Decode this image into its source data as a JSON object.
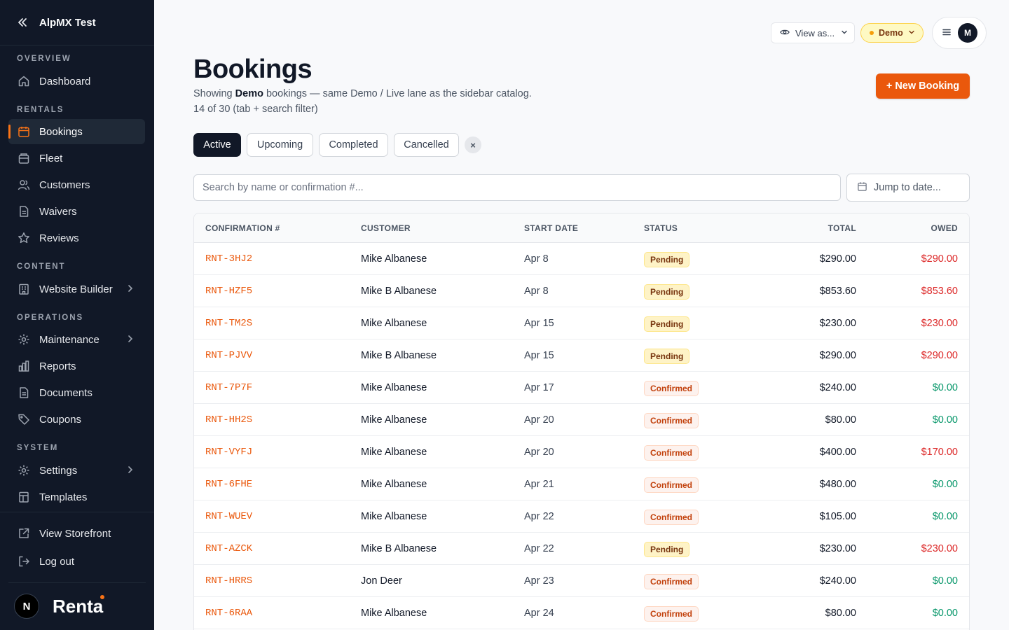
{
  "sidebar": {
    "org_name": "AlpMX Test",
    "sections": {
      "overview": "OVERVIEW",
      "rentals": "RENTALS",
      "content": "CONTENT",
      "operations": "OPERATIONS",
      "system": "SYSTEM"
    },
    "items": {
      "dashboard": "Dashboard",
      "bookings": "Bookings",
      "fleet": "Fleet",
      "customers": "Customers",
      "waivers": "Waivers",
      "reviews": "Reviews",
      "website_builder": "Website Builder",
      "maintenance": "Maintenance",
      "reports": "Reports",
      "documents": "Documents",
      "coupons": "Coupons",
      "settings": "Settings",
      "templates": "Templates"
    },
    "footer_links": {
      "view_storefront": "View Storefront",
      "log_out": "Log out"
    },
    "brand": "Renta",
    "footer_avatar": "N",
    "active_item": "bookings",
    "accent_color": "#f97316"
  },
  "topbar": {
    "view_as": "View as...",
    "mode_badge": "Demo",
    "user_initial": "M"
  },
  "page": {
    "title": "Bookings",
    "subtitle_prefix": "Showing ",
    "subtitle_mode": "Demo",
    "subtitle_suffix": " bookings — same Demo / Live lane as the sidebar catalog.",
    "count_line": "14 of 30 (tab + search filter)",
    "new_booking_label": "+ New Booking"
  },
  "tabs": [
    "Active",
    "Upcoming",
    "Completed",
    "Cancelled"
  ],
  "active_tab": "Active",
  "clear_label": "×",
  "search": {
    "placeholder": "Search by name or confirmation #...",
    "value": ""
  },
  "date_jump": {
    "placeholder": "Jump to date..."
  },
  "table": {
    "columns": [
      "CONFIRMATION #",
      "CUSTOMER",
      "START DATE",
      "STATUS",
      "TOTAL",
      "OWED"
    ],
    "rows": [
      {
        "conf": "RNT-3HJ2",
        "customer": "Mike Albanese",
        "date": "Apr 8",
        "status": "Pending",
        "total": "$290.00",
        "owed": "$290.00"
      },
      {
        "conf": "RNT-HZF5",
        "customer": "Mike B Albanese",
        "date": "Apr 8",
        "status": "Pending",
        "total": "$853.60",
        "owed": "$853.60"
      },
      {
        "conf": "RNT-TM2S",
        "customer": "Mike Albanese",
        "date": "Apr 15",
        "status": "Pending",
        "total": "$230.00",
        "owed": "$230.00"
      },
      {
        "conf": "RNT-PJVV",
        "customer": "Mike B Albanese",
        "date": "Apr 15",
        "status": "Pending",
        "total": "$290.00",
        "owed": "$290.00"
      },
      {
        "conf": "RNT-7P7F",
        "customer": "Mike Albanese",
        "date": "Apr 17",
        "status": "Confirmed",
        "total": "$240.00",
        "owed": "$0.00"
      },
      {
        "conf": "RNT-HH2S",
        "customer": "Mike Albanese",
        "date": "Apr 20",
        "status": "Confirmed",
        "total": "$80.00",
        "owed": "$0.00"
      },
      {
        "conf": "RNT-VYFJ",
        "customer": "Mike Albanese",
        "date": "Apr 20",
        "status": "Confirmed",
        "total": "$400.00",
        "owed": "$170.00"
      },
      {
        "conf": "RNT-6FHE",
        "customer": "Mike Albanese",
        "date": "Apr 21",
        "status": "Confirmed",
        "total": "$480.00",
        "owed": "$0.00"
      },
      {
        "conf": "RNT-WUEV",
        "customer": "Mike Albanese",
        "date": "Apr 22",
        "status": "Confirmed",
        "total": "$105.00",
        "owed": "$0.00"
      },
      {
        "conf": "RNT-AZCK",
        "customer": "Mike B Albanese",
        "date": "Apr 22",
        "status": "Pending",
        "total": "$230.00",
        "owed": "$230.00"
      },
      {
        "conf": "RNT-HRRS",
        "customer": "Jon Deer",
        "date": "Apr 23",
        "status": "Confirmed",
        "total": "$240.00",
        "owed": "$0.00"
      },
      {
        "conf": "RNT-6RAA",
        "customer": "Mike Albanese",
        "date": "Apr 24",
        "status": "Confirmed",
        "total": "$80.00",
        "owed": "$0.00"
      }
    ]
  },
  "colors": {
    "accent": "#ea580c",
    "owed_due": "#dc2626",
    "owed_paid": "#059669",
    "sidebar_bg": "#111827"
  }
}
